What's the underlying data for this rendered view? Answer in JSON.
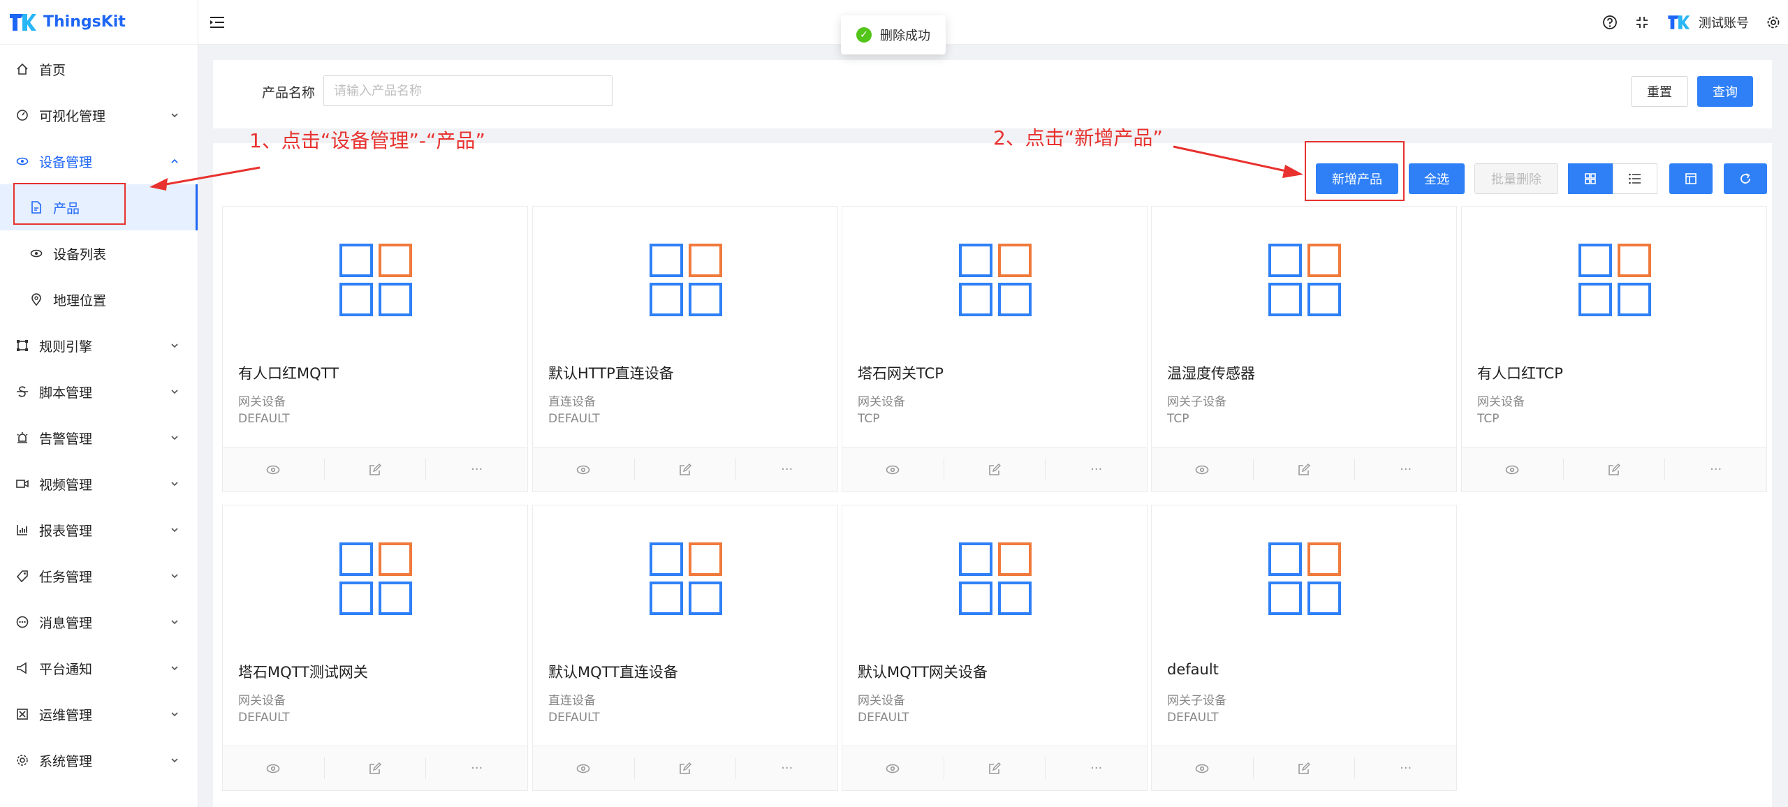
{
  "app": {
    "name": "ThingsKit"
  },
  "sidebar": {
    "items": [
      {
        "label": "首页",
        "icon": "home-icon"
      },
      {
        "label": "可视化管理",
        "icon": "dashboard-icon"
      },
      {
        "label": "设备管理",
        "icon": "eye-icon"
      },
      {
        "label": "产品",
        "icon": "document-icon"
      },
      {
        "label": "设备列表",
        "icon": "eye-icon"
      },
      {
        "label": "地理位置",
        "icon": "location-icon"
      },
      {
        "label": "规则引擎",
        "icon": "rule-engine-icon"
      },
      {
        "label": "脚本管理",
        "icon": "script-icon"
      },
      {
        "label": "告警管理",
        "icon": "alarm-icon"
      },
      {
        "label": "视频管理",
        "icon": "video-icon"
      },
      {
        "label": "报表管理",
        "icon": "report-icon"
      },
      {
        "label": "任务管理",
        "icon": "task-icon"
      },
      {
        "label": "消息管理",
        "icon": "message-icon"
      },
      {
        "label": "平台通知",
        "icon": "notification-icon"
      },
      {
        "label": "运维管理",
        "icon": "ops-icon"
      },
      {
        "label": "系统管理",
        "icon": "settings-icon"
      }
    ]
  },
  "header": {
    "account": "测试账号"
  },
  "toast": {
    "message": "删除成功"
  },
  "search": {
    "label": "产品名称",
    "placeholder": "请输入产品名称",
    "reset": "重置",
    "query": "查询"
  },
  "toolbar": {
    "add": "新增产品",
    "select_all": "全选",
    "batch_delete": "批量删除"
  },
  "cards": [
    {
      "title": "有人口红MQTT",
      "type": "网关设备",
      "protocol": "DEFAULT"
    },
    {
      "title": "默认HTTP直连设备",
      "type": "直连设备",
      "protocol": "DEFAULT"
    },
    {
      "title": "塔石网关TCP",
      "type": "网关设备",
      "protocol": "TCP"
    },
    {
      "title": "温湿度传感器",
      "type": "网关子设备",
      "protocol": "TCP"
    },
    {
      "title": "有人口红TCP",
      "type": "网关设备",
      "protocol": "TCP"
    },
    {
      "title": "塔石MQTT测试网关",
      "type": "网关设备",
      "protocol": "DEFAULT"
    },
    {
      "title": "默认MQTT直连设备",
      "type": "直连设备",
      "protocol": "DEFAULT"
    },
    {
      "title": "默认MQTT网关设备",
      "type": "网关设备",
      "protocol": "DEFAULT"
    },
    {
      "title": "default",
      "type": "网关子设备",
      "protocol": "DEFAULT"
    }
  ],
  "card_action_more": "···",
  "annotations": {
    "step1": "1、点击“设备管理”-“产品”",
    "step2": "2、点击“新增产品”"
  },
  "colors": {
    "primary": "#2f80f7",
    "accent_orange": "#f07a3c",
    "annotation_red": "#e8322f",
    "success": "#52c41a"
  }
}
